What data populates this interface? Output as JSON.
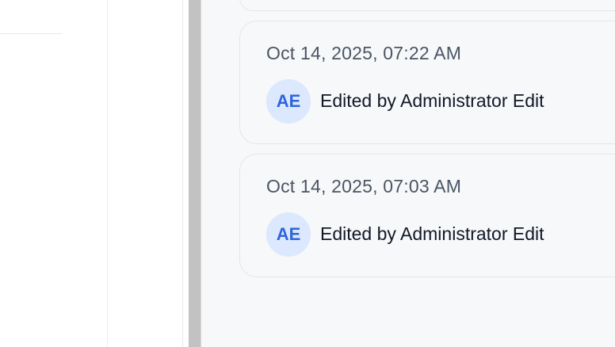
{
  "history": {
    "entries": [
      {
        "timestamp": "Oct 14, 2025, 07:22 AM",
        "avatar_initials": "AE",
        "action_text": "Edited by Administrator Edit"
      },
      {
        "timestamp": "Oct 14, 2025, 07:03 AM",
        "avatar_initials": "AE",
        "action_text": "Edited by Administrator Edit"
      }
    ]
  },
  "colors": {
    "avatar_bg": "#dbe8fd",
    "avatar_text": "#2f64dc",
    "panel_bg": "#f7f8fa",
    "splitter": "#c2c2c2"
  }
}
